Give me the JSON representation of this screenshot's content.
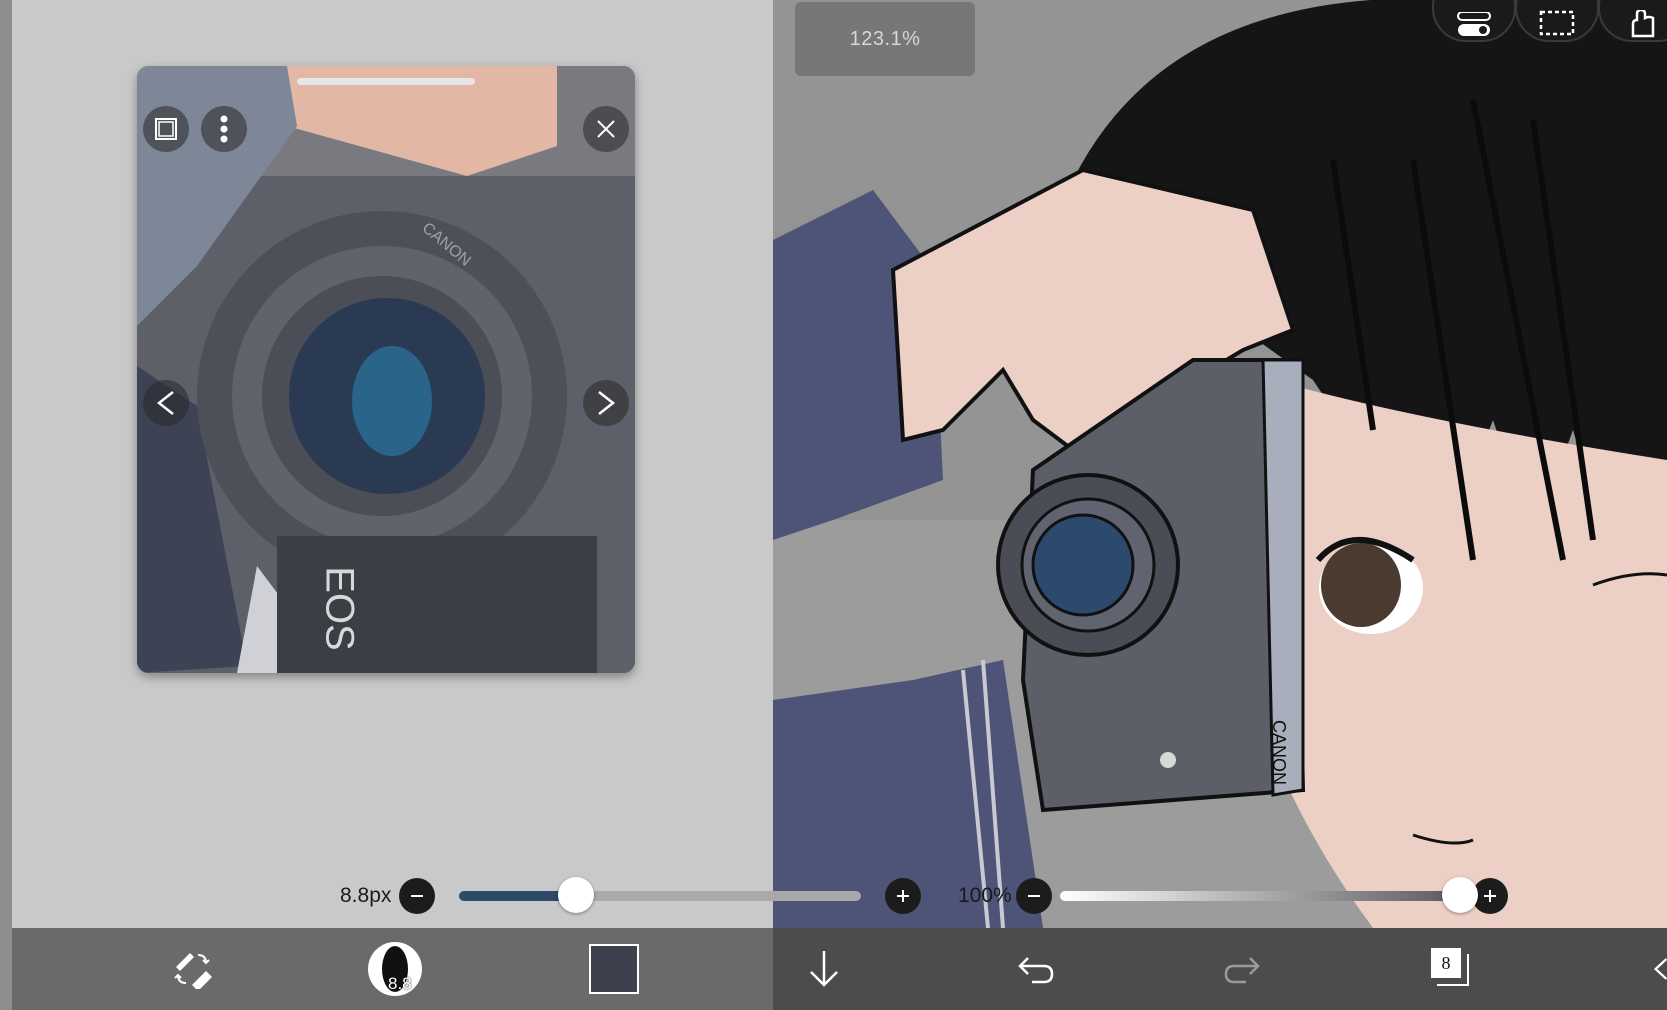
{
  "canvas": {
    "zoom_label": "123.1%"
  },
  "reference_window": {
    "lens_text": "CANON",
    "camera_text": "EOS"
  },
  "brush": {
    "size_label": "8.8px",
    "size_fraction": 0.29,
    "opacity_label": "100%",
    "opacity_fraction": 1.0,
    "brush_preview_label": "8.8"
  },
  "toolbar": {
    "layers_count": "8",
    "color_swatch": "#3f404d"
  },
  "colors": {
    "slider_fill": "#2e4a6b",
    "hair": "#151515",
    "skin": "#ecd0c6",
    "camera": "#5c5f68",
    "jacket": "#4e5477"
  },
  "artwork": {
    "camera_brand": "CANON"
  }
}
